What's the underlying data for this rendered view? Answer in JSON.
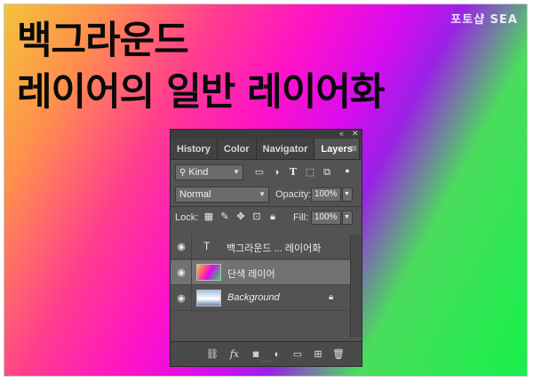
{
  "watermark": "포토샵 SEA",
  "headline": {
    "line1": "백그라운드",
    "line2": "레이어의 일반 레이어화"
  },
  "panel": {
    "collapse": "«",
    "close": "✕",
    "tabs": [
      {
        "label": "History",
        "active": false
      },
      {
        "label": "Color",
        "active": false
      },
      {
        "label": "Navigator",
        "active": false
      },
      {
        "label": "Layers",
        "active": true
      }
    ],
    "menu_icon": "hamburger-menu-icon",
    "filter": {
      "kind_label": "Kind",
      "icons": [
        "pixel-filter-icon",
        "adjustment-filter-icon",
        "type-filter-icon",
        "shape-filter-icon",
        "smart-object-filter-icon",
        "filter-toggle-icon"
      ]
    },
    "blend": {
      "mode": "Normal",
      "opacity_label": "Opacity:",
      "opacity_value": "100%"
    },
    "lock": {
      "label": "Lock:",
      "icons": [
        "lock-transparent-icon",
        "lock-pixels-icon",
        "lock-position-icon",
        "lock-artboard-icon",
        "lock-all-icon"
      ],
      "fill_label": "Fill:",
      "fill_value": "100%"
    },
    "layers": [
      {
        "name": "백그라운드 ... 레이어화",
        "type": "text",
        "selected": false,
        "locked": false,
        "italic": false
      },
      {
        "name": "단색 레이어",
        "type": "solid",
        "selected": true,
        "locked": false,
        "italic": false
      },
      {
        "name": "Background",
        "type": "background",
        "selected": false,
        "locked": true,
        "italic": true
      }
    ],
    "bottom_icons": [
      "link-layers-icon",
      "fx-icon",
      "mask-icon",
      "adjustment-layer-icon",
      "group-folder-icon",
      "new-layer-icon",
      "trash-icon"
    ]
  },
  "colors": {
    "panel_bg": "#535353",
    "tab_bar": "#424242",
    "selected_row": "#727272",
    "gradient": [
      "#f2c33a",
      "#ff3d8e",
      "#ff12c8",
      "#d60cf0",
      "#16f04a"
    ]
  }
}
